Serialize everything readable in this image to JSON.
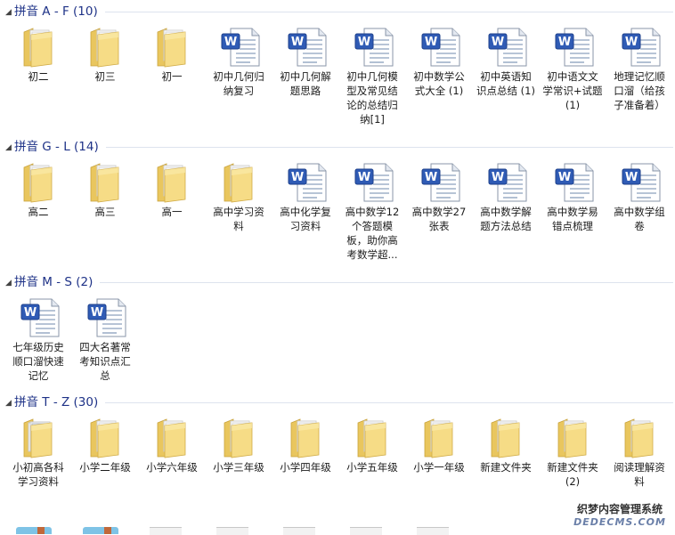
{
  "groups": [
    {
      "title": "拼音 A - F (10)",
      "items": [
        {
          "type": "folder",
          "label": "初二",
          "variant": "open"
        },
        {
          "type": "folder",
          "label": "初三"
        },
        {
          "type": "folder",
          "label": "初一"
        },
        {
          "type": "doc",
          "label": "初中几何归纳复习"
        },
        {
          "type": "doc",
          "label": "初中几何解题思路"
        },
        {
          "type": "doc",
          "label": "初中几何模型及常见结论的总结归纳[1]"
        },
        {
          "type": "doc",
          "label": "初中数学公式大全 (1)"
        },
        {
          "type": "doc",
          "label": "初中英语知识点总结 (1)"
        },
        {
          "type": "doc",
          "label": "初中语文文学常识+试题 (1)"
        },
        {
          "type": "doc",
          "label": "地理记忆顺口溜（给孩子准备着）"
        }
      ]
    },
    {
      "title": "拼音 G - L (14)",
      "items": [
        {
          "type": "folder",
          "label": "高二"
        },
        {
          "type": "folder",
          "label": "高三"
        },
        {
          "type": "folder",
          "label": "高一"
        },
        {
          "type": "folder",
          "label": "高中学习资料"
        },
        {
          "type": "doc",
          "label": "高中化学复习资料"
        },
        {
          "type": "doc",
          "label": "高中数学12个答题模板，助你高考数学超..."
        },
        {
          "type": "doc",
          "label": "高中数学27张表"
        },
        {
          "type": "doc",
          "label": "高中数学解题方法总结"
        },
        {
          "type": "doc",
          "label": "高中数学易错点梳理"
        },
        {
          "type": "doc",
          "label": "高中数学组卷"
        }
      ]
    },
    {
      "title": "拼音 M - S (2)",
      "items": [
        {
          "type": "doc",
          "label": "七年级历史顺口溜快速记忆"
        },
        {
          "type": "doc",
          "label": "四大名著常考知识点汇总"
        }
      ]
    },
    {
      "title": "拼音 T - Z (30)",
      "items": [
        {
          "type": "folder",
          "label": "小初高各科学习资料",
          "variant": "full"
        },
        {
          "type": "folder",
          "label": "小学二年级"
        },
        {
          "type": "folder",
          "label": "小学六年级"
        },
        {
          "type": "folder",
          "label": "小学三年级"
        },
        {
          "type": "folder",
          "label": "小学四年级"
        },
        {
          "type": "folder",
          "label": "小学五年级"
        },
        {
          "type": "folder",
          "label": "小学一年级"
        },
        {
          "type": "folder",
          "label": "新建文件夹"
        },
        {
          "type": "folder",
          "label": "新建文件夹 (2)"
        },
        {
          "type": "folder",
          "label": "阅读理解资料"
        }
      ]
    }
  ],
  "watermark": {
    "line1": "织梦内容管理系统",
    "line2": "DEDECMS.COM"
  },
  "colors": {
    "group_title": "#1e3287",
    "folder": "#f4d77a",
    "doc_blue": "#2f5bb5"
  }
}
